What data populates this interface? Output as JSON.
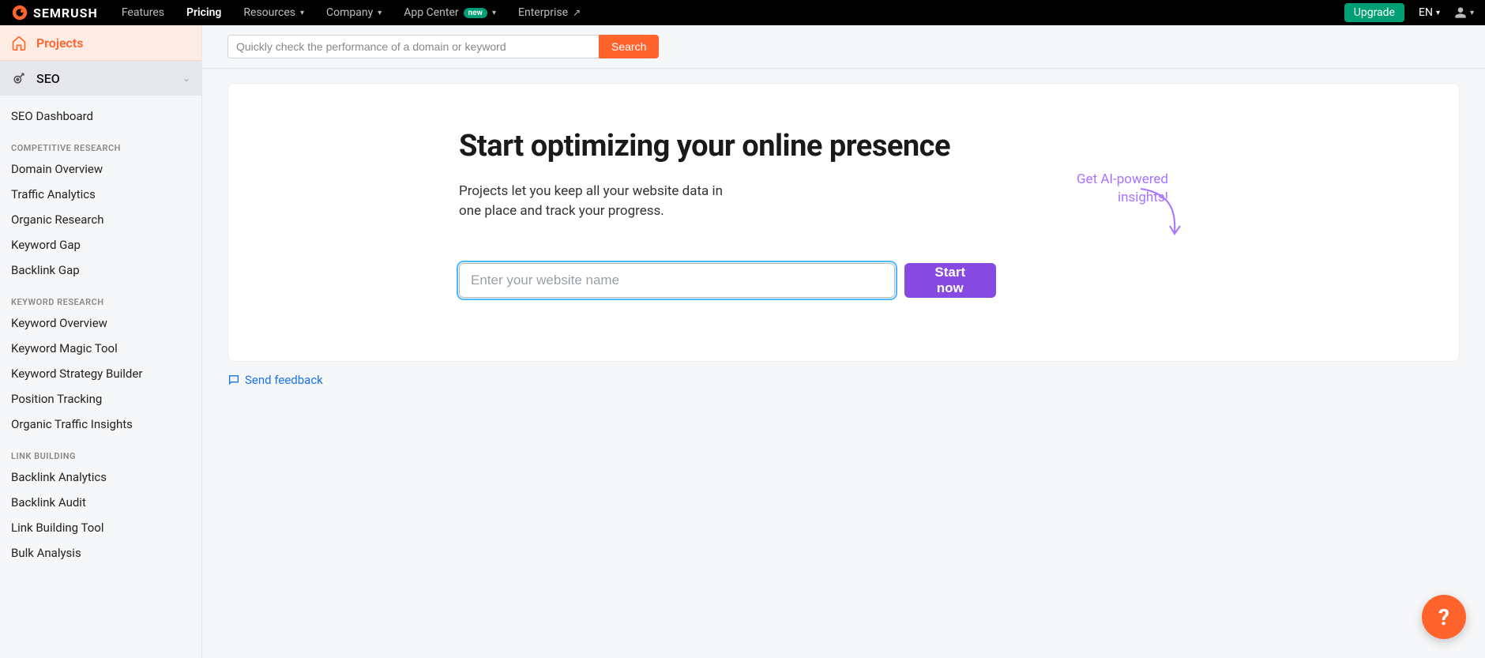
{
  "brand": "SEMRUSH",
  "nav": {
    "features": "Features",
    "pricing": "Pricing",
    "resources": "Resources",
    "company": "Company",
    "app_center": "App Center",
    "app_center_badge": "new",
    "enterprise": "Enterprise"
  },
  "top_right": {
    "upgrade": "Upgrade",
    "lang": "EN"
  },
  "sidebar": {
    "home": "Projects",
    "seo": "SEO",
    "items_top": [
      "SEO Dashboard"
    ],
    "groups": [
      {
        "heading": "COMPETITIVE RESEARCH",
        "items": [
          "Domain Overview",
          "Traffic Analytics",
          "Organic Research",
          "Keyword Gap",
          "Backlink Gap"
        ]
      },
      {
        "heading": "KEYWORD RESEARCH",
        "items": [
          "Keyword Overview",
          "Keyword Magic Tool",
          "Keyword Strategy Builder",
          "Position Tracking",
          "Organic Traffic Insights"
        ]
      },
      {
        "heading": "LINK BUILDING",
        "items": [
          "Backlink Analytics",
          "Backlink Audit",
          "Link Building Tool",
          "Bulk Analysis"
        ]
      }
    ]
  },
  "search": {
    "placeholder": "Quickly check the performance of a domain or keyword",
    "button": "Search"
  },
  "hero": {
    "title": "Start optimizing your online presence",
    "subtitle": "Projects let you keep all your website data in one place and track your progress.",
    "ai_line1": "Get AI-powered",
    "ai_line2": "insights!",
    "input_placeholder": "Enter your website name",
    "start_button": "Start now"
  },
  "feedback": "Send feedback",
  "help": "?"
}
